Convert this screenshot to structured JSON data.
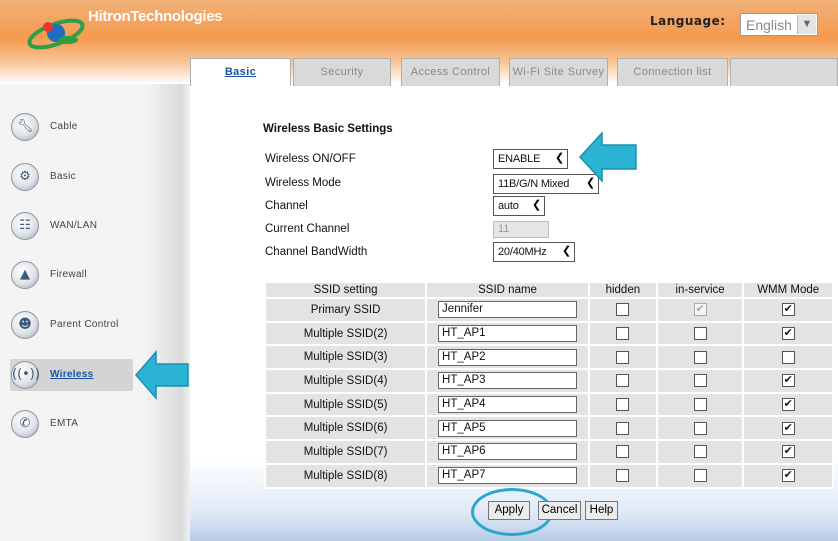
{
  "header": {
    "brand": "HitronTechnologies",
    "language_label": "Language:",
    "language_value": "English",
    "language_arrow": "▼"
  },
  "tabs": [
    {
      "label": "Basic",
      "active": true
    },
    {
      "label": "Security"
    },
    {
      "label": "Access Control"
    },
    {
      "label": "Wi-Fi Site Survey"
    },
    {
      "label": "Connection list"
    }
  ],
  "sidebar": {
    "items": [
      {
        "label": "Cable",
        "icon": "wrench-icon"
      },
      {
        "label": "Basic",
        "icon": "gear-icon"
      },
      {
        "label": "WAN/LAN",
        "icon": "network-icon"
      },
      {
        "label": "Firewall",
        "icon": "flame-icon"
      },
      {
        "label": "Parent Control",
        "icon": "users-icon"
      },
      {
        "label": "Wireless",
        "icon": "wireless-icon",
        "active": true
      },
      {
        "label": "EMTA",
        "icon": "phone-icon"
      }
    ]
  },
  "form": {
    "title": "Wireless Basic Settings",
    "wireless_onoff_label": "Wireless ON/OFF",
    "wireless_onoff_value": "ENABLE",
    "wireless_mode_label": "Wireless Mode",
    "wireless_mode_value": "11B/G/N Mixed",
    "channel_label": "Channel",
    "channel_value": "auto",
    "current_channel_label": "Current Channel",
    "current_channel_value": "11",
    "bandwidth_label": "Channel BandWidth",
    "bandwidth_value": "20/40MHz"
  },
  "table": {
    "headers": [
      "SSID setting",
      "SSID name",
      "hidden",
      "in-service",
      "WMM Mode"
    ],
    "rows": [
      {
        "setting": "Primary SSID",
        "name": "Jennifer",
        "hidden": false,
        "in_service": true,
        "in_service_disabled": true,
        "wmm": true
      },
      {
        "setting": "Multiple SSID(2)",
        "name": "HT_AP1",
        "hidden": false,
        "in_service": false,
        "wmm": true
      },
      {
        "setting": "Multiple SSID(3)",
        "name": "HT_AP2",
        "hidden": false,
        "in_service": false,
        "wmm": false
      },
      {
        "setting": "Multiple SSID(4)",
        "name": "HT_AP3",
        "hidden": false,
        "in_service": false,
        "wmm": true
      },
      {
        "setting": "Multiple SSID(5)",
        "name": "HT_AP4",
        "hidden": false,
        "in_service": false,
        "wmm": true
      },
      {
        "setting": "Multiple SSID(6)",
        "name": "HT_AP5",
        "hidden": false,
        "in_service": false,
        "wmm": true
      },
      {
        "setting": "Multiple SSID(7)",
        "name": "HT_AP6",
        "hidden": false,
        "in_service": false,
        "wmm": true
      },
      {
        "setting": "Multiple SSID(8)",
        "name": "HT_AP7",
        "hidden": false,
        "in_service": false,
        "wmm": true
      }
    ]
  },
  "buttons": {
    "apply": "Apply",
    "cancel": "Cancel",
    "help": "Help"
  },
  "colors": {
    "accent_arrow": "#2bb3d4",
    "link_blue": "#1b55a6",
    "header_orange": "#f49a4f"
  }
}
